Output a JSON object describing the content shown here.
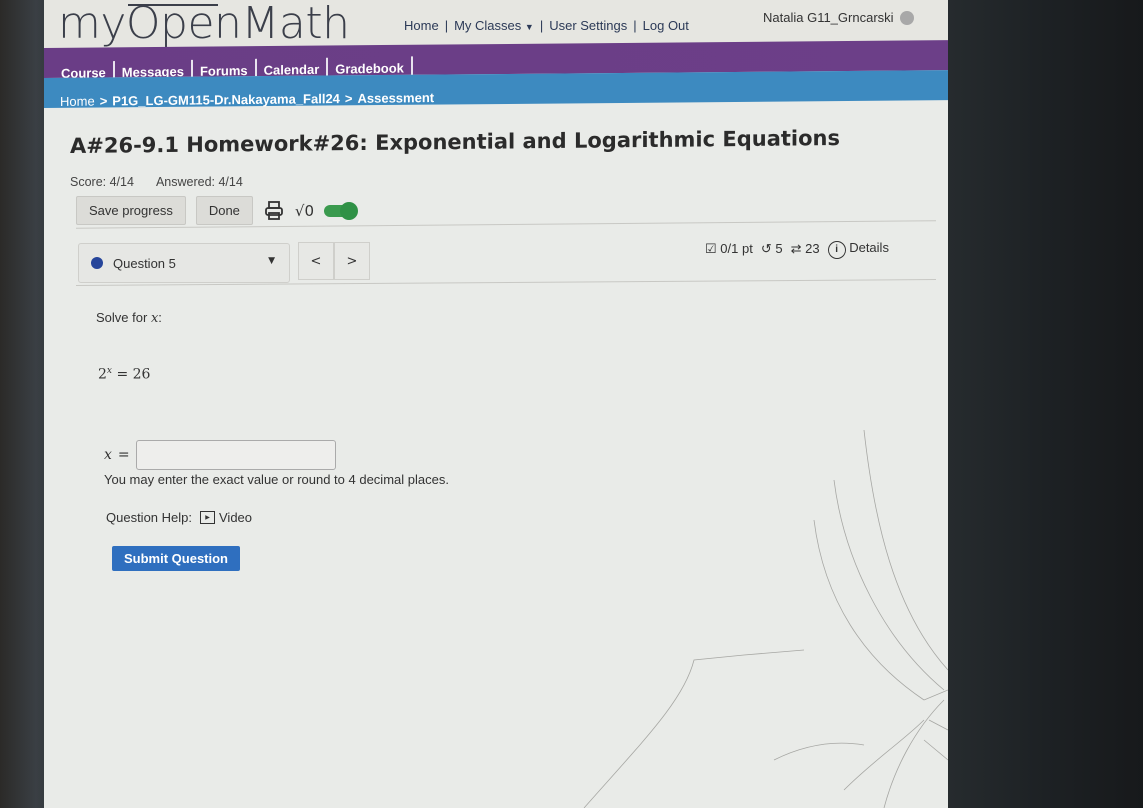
{
  "app": {
    "logo": "myOpenMath",
    "top_nav": [
      {
        "label": "Home"
      },
      {
        "label": "My Classes"
      },
      {
        "label": "User Settings"
      },
      {
        "label": "Log Out"
      }
    ],
    "separators": [
      "|",
      "|",
      "|"
    ],
    "user_name": "Natalia G11_Grncarski"
  },
  "nav_tabs": [
    {
      "label": "Course"
    },
    {
      "label": "Messages"
    },
    {
      "label": "Forums"
    },
    {
      "label": "Calendar"
    },
    {
      "label": "Gradebook"
    }
  ],
  "breadcrumb": {
    "items": [
      "Home",
      "P1G_LG-GM115-Dr.Nakayama_Fall24",
      "Assessment"
    ],
    "separator": ">"
  },
  "assessment": {
    "title": "A#26-9.1 Homework#26: Exponential and Logarithmic Equations",
    "score": "Score: 4/14",
    "answered": "Answered: 4/14",
    "save_label": "Save progress",
    "done_label": "Done",
    "math_toggle_label": "√0",
    "math_toggle_on": true
  },
  "question": {
    "selector_label": "Question 5",
    "prev": "<",
    "next": ">",
    "points": "0/1 pt",
    "retries": "5",
    "regens": "23",
    "details": "Details",
    "prompt_text": "Solve for",
    "prompt_var": "x",
    "prompt_colon": ":",
    "equation_base": "2",
    "equation_exp": "x",
    "equation_rhs": "= 26",
    "answer_label_var": "x",
    "answer_label_eq": "=",
    "answer_value": "",
    "hint": "You may enter the exact value or round to 4 decimal places.",
    "help_label": "Question Help:",
    "help_video": "Video",
    "submit_label": "Submit Question"
  },
  "colors": {
    "nav_purple": "#6a3d86",
    "breadcrumb_blue": "#3d8ac0",
    "submit_blue": "#2f6fbf",
    "toggle_green": "#2f9146",
    "question_bullet": "#26459a"
  }
}
